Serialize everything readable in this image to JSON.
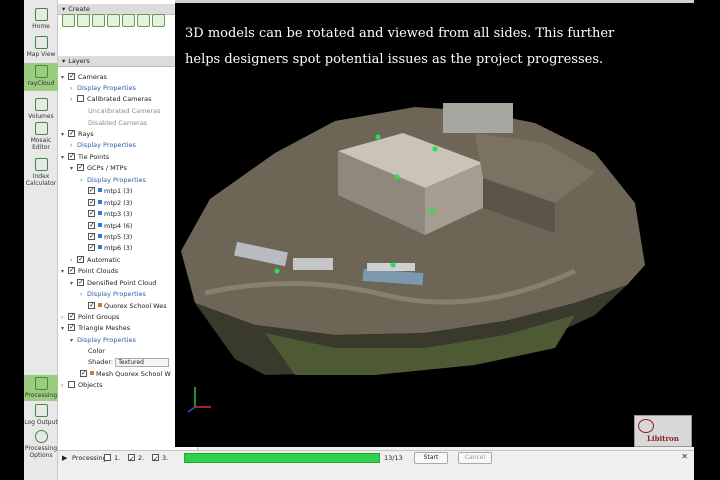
{
  "leftbar": {
    "items": [
      {
        "label": "Home",
        "icon": "home-icon"
      },
      {
        "label": "Map View",
        "icon": "map-icon"
      },
      {
        "label": "rayCloud",
        "icon": "raycloud-icon"
      },
      {
        "label": "Volumes",
        "icon": "volumes-icon"
      },
      {
        "label": "Mosaic Editor",
        "icon": "mosaic-icon"
      },
      {
        "label": "Index Calculator",
        "icon": "calculator-icon"
      },
      {
        "label": "Processing",
        "icon": "processing-icon"
      },
      {
        "label": "Log Output",
        "icon": "log-icon"
      },
      {
        "label": "Processing Options",
        "icon": "gear-icon"
      }
    ]
  },
  "panel": {
    "create_header": "Create",
    "layers_header": "Layers",
    "tree": {
      "cameras": "Cameras",
      "display_properties": "Display Properties",
      "calibrated_cameras": "Calibrated Cameras",
      "uncalibrated_cameras": "Uncalibrated Cameras",
      "disabled_cameras": "Disabled Cameras",
      "rays": "Rays",
      "tie_points": "Tie Points",
      "gcps_mtps": "GCPs / MTPs",
      "mtp1": "mtp1 (3)",
      "mtp2": "mtp2 (3)",
      "mtp3": "mtp3 (3)",
      "mtp4": "mtp4 (6)",
      "mtp5": "mtp5 (3)",
      "mtp6": "mtp6 (3)",
      "automatic": "Automatic",
      "point_clouds": "Point Clouds",
      "densified_point_cloud": "Densified Point Cloud",
      "quorex_cloud": "Quorex School Wes",
      "point_groups": "Point Groups",
      "triangle_meshes": "Triangle Meshes",
      "color": "Color",
      "shader": "Shader:",
      "shader_value": "Textured",
      "mesh_quorex": "Mesh Quorex School W",
      "objects": "Objects"
    }
  },
  "viewport": {
    "caption_line1": "3D models  can be rotated and viewed from all sides. This further",
    "caption_line2": "helps designers spot potential issues as the project progresses.",
    "logo_text": "Libitron"
  },
  "statusbar": {
    "processing_label": "Processing",
    "step1": "1.",
    "step2": "2.",
    "step3": "3.",
    "progress_fraction": 1.0,
    "progress_text": "13/13",
    "start_label": "Start",
    "cancel_label": "Cancel"
  },
  "colors": {
    "accent_green": "#2fd14a",
    "active_tool": "#9ccc80",
    "link_blue": "#2b5fa8"
  }
}
